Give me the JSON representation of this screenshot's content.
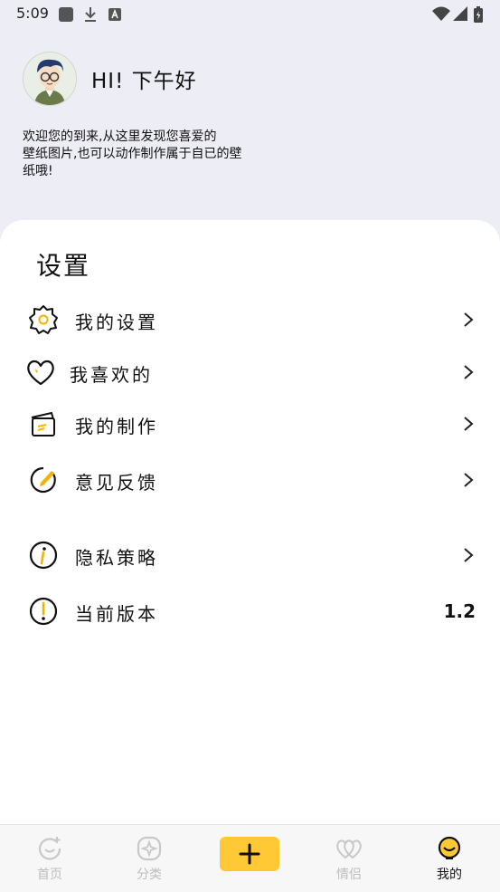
{
  "status": {
    "time": "5:09"
  },
  "header": {
    "greeting": "HI! 下午好",
    "welcome_line1": "欢迎您的到来,从这里发现您喜爱的",
    "welcome_line2": "壁纸图片,也可以动作制作属于自已的壁",
    "welcome_line3": "纸哦!"
  },
  "settings": {
    "title": "设置",
    "items": [
      {
        "label": "我的设置",
        "icon": "gear-icon"
      },
      {
        "label": "我喜欢的",
        "icon": "heart-icon"
      },
      {
        "label": "我的制作",
        "icon": "cards-icon"
      },
      {
        "label": "意见反馈",
        "icon": "feedback-pencil-icon"
      },
      {
        "label": "隐私策略",
        "icon": "info-icon"
      },
      {
        "label": "当前版本",
        "icon": "exclamation-icon",
        "value": "1.2"
      }
    ]
  },
  "tabbar": {
    "tabs": [
      {
        "label": "首页",
        "icon": "home-smile-icon",
        "active": false
      },
      {
        "label": "分类",
        "icon": "category-icon",
        "active": false
      },
      {
        "label": "情侣",
        "icon": "couple-hearts-icon",
        "active": false
      },
      {
        "label": "我的",
        "icon": "profile-face-icon",
        "active": true
      }
    ],
    "add_icon": "plus-icon"
  },
  "colors": {
    "accent": "#ffc935",
    "background": "#ededf5",
    "card": "#ffffff",
    "inactive_tab": "#bdbdbd"
  }
}
